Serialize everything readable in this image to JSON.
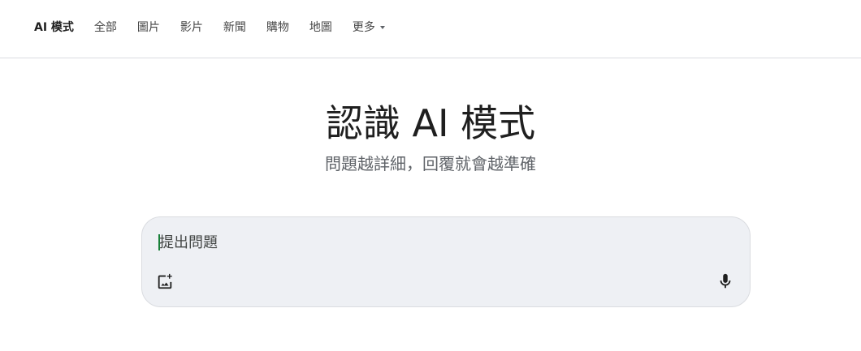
{
  "nav": {
    "tabs": [
      {
        "label": "AI 模式",
        "active": true
      },
      {
        "label": "全部",
        "active": false
      },
      {
        "label": "圖片",
        "active": false
      },
      {
        "label": "影片",
        "active": false
      },
      {
        "label": "新聞",
        "active": false
      },
      {
        "label": "購物",
        "active": false
      },
      {
        "label": "地圖",
        "active": false
      }
    ],
    "more_label": "更多"
  },
  "hero": {
    "title": "認識 AI 模式",
    "subtitle": "問題越詳細，回覆就會越準確"
  },
  "search": {
    "placeholder": "提出問題",
    "value": "",
    "icons": {
      "image": "add-image-icon",
      "mic": "microphone-icon"
    }
  },
  "colors": {
    "search_bg": "#eef0f4",
    "caret": "#188038",
    "divider": "#dadce0"
  }
}
